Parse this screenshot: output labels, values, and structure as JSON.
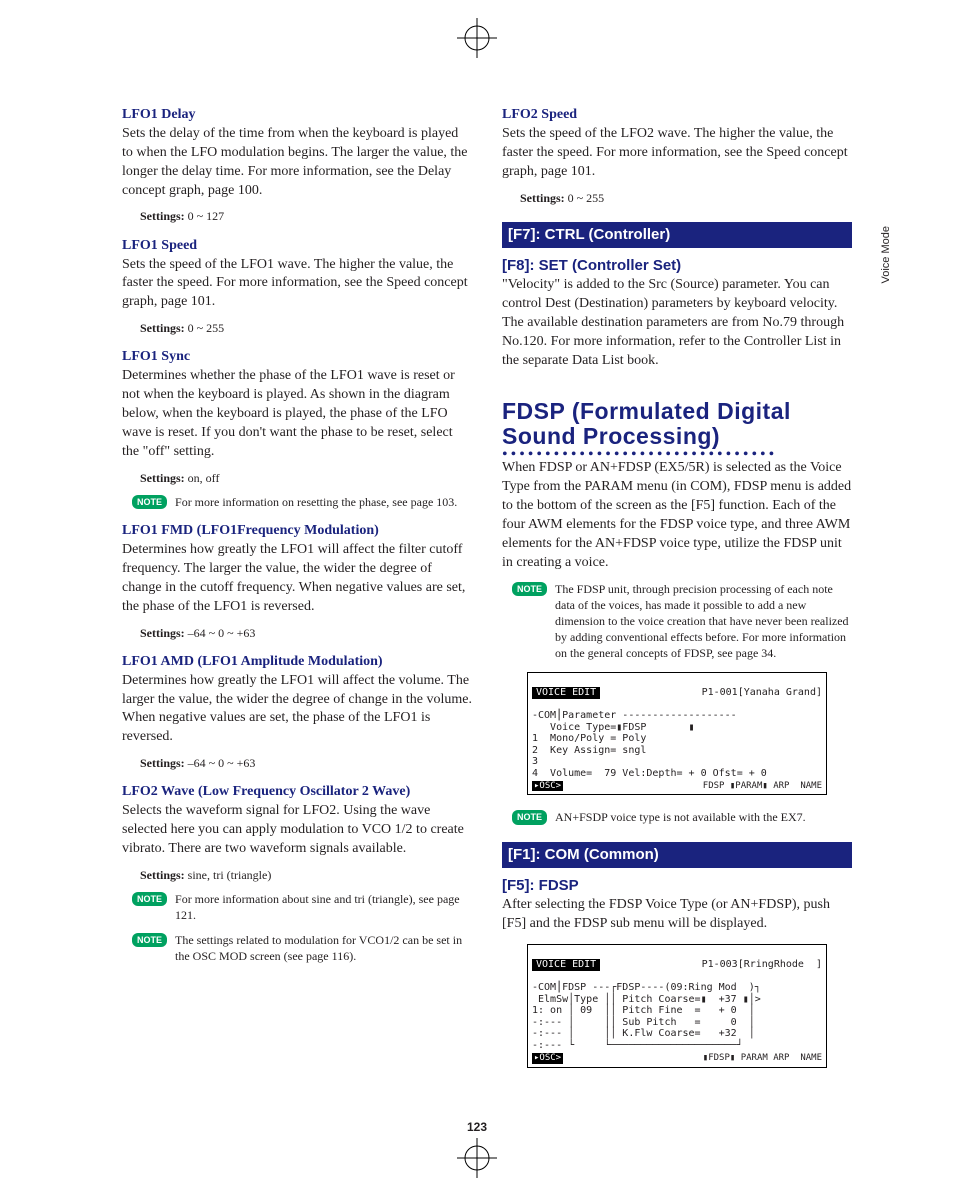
{
  "sideTab": "Voice Mode",
  "pageNumber": "123",
  "noteLabel": "NOTE",
  "left": {
    "lfo1delay": {
      "title": "LFO1 Delay",
      "body": "Sets the delay of the time from when the keyboard is played to when the LFO modulation begins. The larger the value, the longer the delay time. For more information, see the Delay concept graph, page 100.",
      "settings": "Settings: 0 ~ 127"
    },
    "lfo1speed": {
      "title": "LFO1 Speed",
      "body": "Sets the speed of the LFO1 wave. The higher the value, the faster the speed. For more information, see the Speed concept graph, page 101.",
      "settings": "Settings: 0 ~ 255"
    },
    "lfo1sync": {
      "title": "LFO1 Sync",
      "body": "Determines whether the phase of the LFO1 wave is reset or not when the keyboard is played. As shown in the diagram below, when the keyboard is played, the phase of the LFO wave is reset. If you don't want the phase to be reset, select the \"off\" setting.",
      "settings": "Settings: on, off",
      "note": "For more information on resetting the phase, see page 103."
    },
    "lfo1fmd": {
      "title": "LFO1 FMD (LFO1Frequency Modulation)",
      "body": "Determines how greatly the LFO1 will affect the filter cutoff frequency. The larger the value, the wider the degree of change in the cutoff frequency. When negative values are set, the phase of the LFO1 is reversed.",
      "settings": "Settings: –64 ~ 0 ~ +63"
    },
    "lfo1amd": {
      "title": "LFO1 AMD (LFO1 Amplitude Modulation)",
      "body": "Determines how greatly the LFO1 will affect the volume. The larger the value, the wider the degree of change in the volume. When negative values are set, the phase of the LFO1 is reversed.",
      "settings": "Settings: –64 ~ 0 ~ +63"
    },
    "lfo2wave": {
      "title": "LFO2 Wave (Low Frequency Oscillator 2 Wave)",
      "body": "Selects the waveform signal for LFO2. Using the wave selected here you can apply modulation to VCO 1/2 to create vibrato. There are two waveform signals available.",
      "settings": "Settings: sine, tri (triangle)",
      "note1": "For more information about sine and tri (triangle), see page 121.",
      "note2": "The settings related to modulation for VCO1/2 can be set in the OSC MOD screen (see page 116)."
    }
  },
  "right": {
    "lfo2speed": {
      "title": "LFO2 Speed",
      "body": "Sets the speed of the LFO2 wave. The higher the value, the faster the speed. For more information, see the Speed concept graph, page 101.",
      "settings": "Settings: 0 ~ 255"
    },
    "f7": "[F7]: CTRL (Controller)",
    "f8": {
      "title": "[F8]: SET (Controller Set)",
      "body": "\"Velocity\" is added to the Src (Source) parameter. You can control Dest (Destination) parameters by keyboard velocity. The available destination parameters are from No.79 through No.120. For more information, refer to the Controller List in the separate Data List book."
    },
    "fdsp": {
      "title": "FDSP (Formulated Digital Sound Processing)",
      "body": "When FDSP or AN+FDSP (EX5/5R) is selected as the Voice Type from the PARAM menu (in COM), FDSP menu is added to the bottom of the screen as the [F5] function. Each of the four AWM elements for the FDSP voice type, and three AWM elements for the AN+FDSP voice type, utilize the FDSP unit in creating a voice.",
      "note1": "The FDSP unit, through precision processing of each note data of the voices, has made it possible to add a new dimension to the voice creation that have never been realized by adding conventional effects before. For more information on the general concepts of FDSP, see page 34.",
      "note2": "AN+FSDP voice type is not available with the EX7."
    },
    "lcd1": {
      "headerL": "VOICE EDIT",
      "headerR": "P1-001[Yanaha Grand]",
      "l1": "-COM⎮Parameter -------------------",
      "l2": "   Voice Type=▮FDSP       ▮",
      "l3": "1  Mono/Poly = Poly",
      "l4": "2  Key Assign= sngl",
      "l5": "3",
      "l6": "4  Volume=  79 Vel:Depth= + 0 Ofst= + 0",
      "ftrL": "▸OSC>",
      "ftrR": "FDSP ▮PARAM▮ ARP  NAME"
    },
    "f1": "[F1]: COM (Common)",
    "f5": {
      "title": "[F5]: FDSP",
      "body": "After selecting the FDSP Voice Type (or AN+FDSP), push [F5] and the FDSP sub menu will be displayed."
    },
    "lcd2": {
      "headerL": "VOICE EDIT",
      "headerR": "P1-003[RringRhode  ]",
      "l1": "-COM⎮FDSP ---┌FDSP----(09:Ring Mod  )┐",
      "l2": " ElmSw│Type ││ Pitch Coarse=▮  +37 ▮│>",
      "l3": "1: on │ 09  ││ Pitch Fine  =   + 0  │",
      "l4": "-:--- │     ││ Sub Pitch   =     0  │",
      "l5": "-:--- │     ││ K.Flw Coarse=   +32  │",
      "l6": "-:--- └     └─────────────────────┘",
      "ftrL": "▸OSC>",
      "ftrR": "▮FDSP▮ PARAM ARP  NAME"
    }
  }
}
